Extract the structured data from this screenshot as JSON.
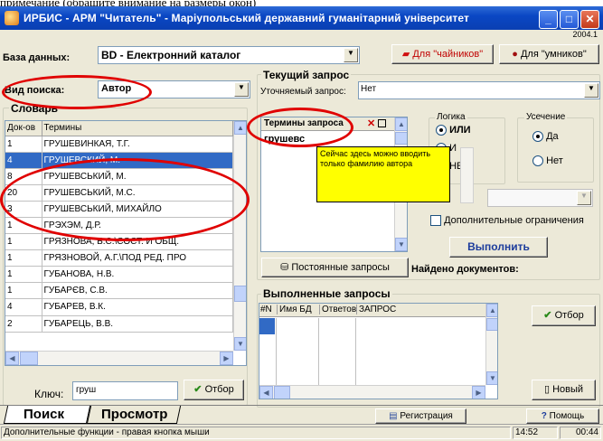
{
  "window": {
    "title": "ИРБИС - АРМ \"Читатель\" - Маріупольський державний гуманітарний університет",
    "version": "2004.1",
    "top_caption": "примечание (обращите внимание на размеры окон)"
  },
  "toolbar": {
    "db_label": "База данных:",
    "db_value": "BD - Електронний каталог",
    "novice_btn": "Для \"чайников\"",
    "expert_btn": "Для \"умников\""
  },
  "search": {
    "type_label": "Вид поиска:",
    "type_value": "Автор"
  },
  "dictionary": {
    "title": "Словарь",
    "col_docs": "Док-ов",
    "col_terms": "Термины",
    "rows": [
      {
        "docs": "1",
        "term": "ГРУШЕВИНКАЯ, Т.Г."
      },
      {
        "docs": "4",
        "term": "ГРУШЕВСКИЙ, М."
      },
      {
        "docs": "8",
        "term": "ГРУШЕВСЬКИЙ, М."
      },
      {
        "docs": "20",
        "term": "ГРУШЕВСЬКИЙ, М.С."
      },
      {
        "docs": "3",
        "term": "ГРУШЕВСЬКИЙ, МИХАЙЛО"
      },
      {
        "docs": "1",
        "term": "ГРЭХЭМ, Д.Р."
      },
      {
        "docs": "1",
        "term": "ГРЯЗНОВА, Б.С.\\СОСТ. И ОБЩ."
      },
      {
        "docs": "1",
        "term": "ГРЯЗНОВОЙ, А.Г.\\ПОД РЕД. ПРО"
      },
      {
        "docs": "1",
        "term": "ГУБАНОВА, Н.В."
      },
      {
        "docs": "1",
        "term": "ГУБАРЄВ, С.В."
      },
      {
        "docs": "4",
        "term": "ГУБАРЕВ, В.К."
      },
      {
        "docs": "2",
        "term": "ГУБАРЕЦЬ, В.В."
      }
    ],
    "key_label": "Ключ:",
    "key_value": "груш",
    "select_btn": "Отбор"
  },
  "current_query": {
    "title": "Текущий запрос",
    "refine_label": "Уточняемый запрос:",
    "refine_value": "Нет",
    "terms_header": "Термины запроса",
    "term_value": "грушевс",
    "tooltip": "Сейчас здесь можно вводить только фамилию автора",
    "permanent_btn": "Постоянные запросы",
    "found_label": "Найдено документов:"
  },
  "logic": {
    "title": "Логика",
    "or": "ИЛИ",
    "and": "И",
    "not": "НЕ"
  },
  "truncation": {
    "title": "Усечение",
    "yes": "Да",
    "no": "Нет"
  },
  "extra_restrictions": "Дополнительные ограничения",
  "run_btn": "Выполнить",
  "done_queries": {
    "title": "Выполненные запросы",
    "cols": [
      "#N",
      "Имя БД",
      "Ответов",
      "ЗАПРОС"
    ],
    "select_btn": "Отбор",
    "new_btn": "Новый"
  },
  "tabs": {
    "search": "Поиск",
    "view": "Просмотр"
  },
  "bottom": {
    "register_btn": "Регистрация",
    "help_btn": "Помощь"
  },
  "statusbar": {
    "hint": "Дополнительные функции - правая кнопка мыши",
    "time": "14:52",
    "elapsed": "00:44"
  },
  "colors": {
    "title_blue": "#0a47c4",
    "selection": "#316ac5",
    "tooltip": "#ffff00",
    "annotation_red": "#e00000"
  }
}
